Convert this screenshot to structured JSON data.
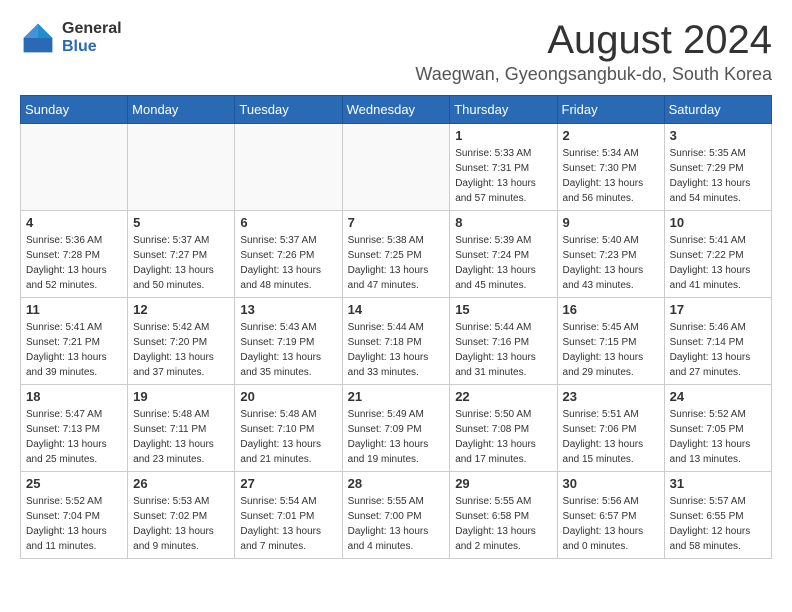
{
  "header": {
    "logo_general": "General",
    "logo_blue": "Blue",
    "month_title": "August 2024",
    "location": "Waegwan, Gyeongsangbuk-do, South Korea"
  },
  "weekdays": [
    "Sunday",
    "Monday",
    "Tuesday",
    "Wednesday",
    "Thursday",
    "Friday",
    "Saturday"
  ],
  "weeks": [
    [
      {
        "day": "",
        "info": ""
      },
      {
        "day": "",
        "info": ""
      },
      {
        "day": "",
        "info": ""
      },
      {
        "day": "",
        "info": ""
      },
      {
        "day": "1",
        "info": "Sunrise: 5:33 AM\nSunset: 7:31 PM\nDaylight: 13 hours\nand 57 minutes."
      },
      {
        "day": "2",
        "info": "Sunrise: 5:34 AM\nSunset: 7:30 PM\nDaylight: 13 hours\nand 56 minutes."
      },
      {
        "day": "3",
        "info": "Sunrise: 5:35 AM\nSunset: 7:29 PM\nDaylight: 13 hours\nand 54 minutes."
      }
    ],
    [
      {
        "day": "4",
        "info": "Sunrise: 5:36 AM\nSunset: 7:28 PM\nDaylight: 13 hours\nand 52 minutes."
      },
      {
        "day": "5",
        "info": "Sunrise: 5:37 AM\nSunset: 7:27 PM\nDaylight: 13 hours\nand 50 minutes."
      },
      {
        "day": "6",
        "info": "Sunrise: 5:37 AM\nSunset: 7:26 PM\nDaylight: 13 hours\nand 48 minutes."
      },
      {
        "day": "7",
        "info": "Sunrise: 5:38 AM\nSunset: 7:25 PM\nDaylight: 13 hours\nand 47 minutes."
      },
      {
        "day": "8",
        "info": "Sunrise: 5:39 AM\nSunset: 7:24 PM\nDaylight: 13 hours\nand 45 minutes."
      },
      {
        "day": "9",
        "info": "Sunrise: 5:40 AM\nSunset: 7:23 PM\nDaylight: 13 hours\nand 43 minutes."
      },
      {
        "day": "10",
        "info": "Sunrise: 5:41 AM\nSunset: 7:22 PM\nDaylight: 13 hours\nand 41 minutes."
      }
    ],
    [
      {
        "day": "11",
        "info": "Sunrise: 5:41 AM\nSunset: 7:21 PM\nDaylight: 13 hours\nand 39 minutes."
      },
      {
        "day": "12",
        "info": "Sunrise: 5:42 AM\nSunset: 7:20 PM\nDaylight: 13 hours\nand 37 minutes."
      },
      {
        "day": "13",
        "info": "Sunrise: 5:43 AM\nSunset: 7:19 PM\nDaylight: 13 hours\nand 35 minutes."
      },
      {
        "day": "14",
        "info": "Sunrise: 5:44 AM\nSunset: 7:18 PM\nDaylight: 13 hours\nand 33 minutes."
      },
      {
        "day": "15",
        "info": "Sunrise: 5:44 AM\nSunset: 7:16 PM\nDaylight: 13 hours\nand 31 minutes."
      },
      {
        "day": "16",
        "info": "Sunrise: 5:45 AM\nSunset: 7:15 PM\nDaylight: 13 hours\nand 29 minutes."
      },
      {
        "day": "17",
        "info": "Sunrise: 5:46 AM\nSunset: 7:14 PM\nDaylight: 13 hours\nand 27 minutes."
      }
    ],
    [
      {
        "day": "18",
        "info": "Sunrise: 5:47 AM\nSunset: 7:13 PM\nDaylight: 13 hours\nand 25 minutes."
      },
      {
        "day": "19",
        "info": "Sunrise: 5:48 AM\nSunset: 7:11 PM\nDaylight: 13 hours\nand 23 minutes."
      },
      {
        "day": "20",
        "info": "Sunrise: 5:48 AM\nSunset: 7:10 PM\nDaylight: 13 hours\nand 21 minutes."
      },
      {
        "day": "21",
        "info": "Sunrise: 5:49 AM\nSunset: 7:09 PM\nDaylight: 13 hours\nand 19 minutes."
      },
      {
        "day": "22",
        "info": "Sunrise: 5:50 AM\nSunset: 7:08 PM\nDaylight: 13 hours\nand 17 minutes."
      },
      {
        "day": "23",
        "info": "Sunrise: 5:51 AM\nSunset: 7:06 PM\nDaylight: 13 hours\nand 15 minutes."
      },
      {
        "day": "24",
        "info": "Sunrise: 5:52 AM\nSunset: 7:05 PM\nDaylight: 13 hours\nand 13 minutes."
      }
    ],
    [
      {
        "day": "25",
        "info": "Sunrise: 5:52 AM\nSunset: 7:04 PM\nDaylight: 13 hours\nand 11 minutes."
      },
      {
        "day": "26",
        "info": "Sunrise: 5:53 AM\nSunset: 7:02 PM\nDaylight: 13 hours\nand 9 minutes."
      },
      {
        "day": "27",
        "info": "Sunrise: 5:54 AM\nSunset: 7:01 PM\nDaylight: 13 hours\nand 7 minutes."
      },
      {
        "day": "28",
        "info": "Sunrise: 5:55 AM\nSunset: 7:00 PM\nDaylight: 13 hours\nand 4 minutes."
      },
      {
        "day": "29",
        "info": "Sunrise: 5:55 AM\nSunset: 6:58 PM\nDaylight: 13 hours\nand 2 minutes."
      },
      {
        "day": "30",
        "info": "Sunrise: 5:56 AM\nSunset: 6:57 PM\nDaylight: 13 hours\nand 0 minutes."
      },
      {
        "day": "31",
        "info": "Sunrise: 5:57 AM\nSunset: 6:55 PM\nDaylight: 12 hours\nand 58 minutes."
      }
    ]
  ]
}
